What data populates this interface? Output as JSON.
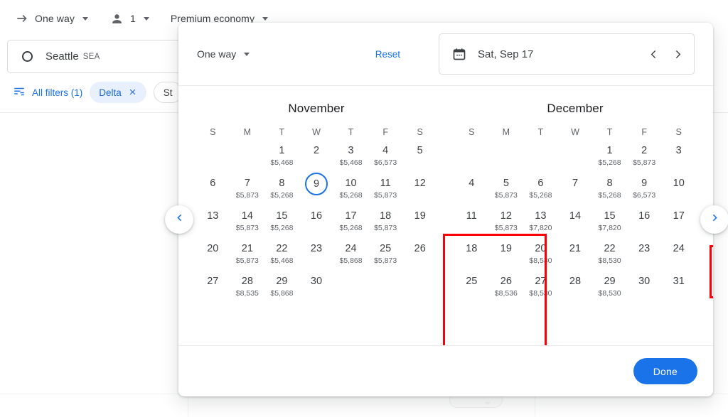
{
  "background": {
    "toolbar": {
      "trip_type": {
        "label": "One way",
        "icon": "arrow-right-icon"
      },
      "passengers": {
        "label": "1",
        "icon": "person-icon"
      },
      "cabin_class": {
        "label": "Premium economy"
      }
    },
    "search": {
      "origin_city": "Seattle",
      "origin_code": "SEA",
      "origin_icon": "circle-origin-icon"
    },
    "filters": {
      "all_filters_label": "All filters (1)",
      "all_filters_icon": "tune-icon",
      "chips": [
        {
          "label": "Delta",
          "removable": true,
          "state": "active"
        },
        {
          "label": "St",
          "removable": false,
          "state": "plain"
        }
      ]
    }
  },
  "nav": {
    "prev_icon": "chevron-left-icon",
    "next_icon": "chevron-right-icon"
  },
  "dialog": {
    "header": {
      "trip_type_label": "One way",
      "trip_type_caret": "chevron-down-icon",
      "reset_label": "Reset",
      "date_field": {
        "icon": "calendar-icon",
        "value": "Sat, Sep 17",
        "prev_icon": "chevron-left-icon",
        "next_icon": "chevron-right-icon"
      }
    },
    "weekday_headers": [
      "S",
      "M",
      "T",
      "W",
      "T",
      "F",
      "S"
    ],
    "months": [
      {
        "name": "November",
        "lead_blanks": 2,
        "days": [
          {
            "day": 1,
            "price": "$5,468"
          },
          {
            "day": 2,
            "price": ""
          },
          {
            "day": 3,
            "price": "$5,468"
          },
          {
            "day": 4,
            "price": "$6,573"
          },
          {
            "day": 5,
            "price": ""
          },
          {
            "day": 6,
            "price": ""
          },
          {
            "day": 7,
            "price": "$5,873"
          },
          {
            "day": 8,
            "price": "$5,268"
          },
          {
            "day": 9,
            "price": "",
            "selected": true
          },
          {
            "day": 10,
            "price": "$5,268"
          },
          {
            "day": 11,
            "price": "$5,873"
          },
          {
            "day": 12,
            "price": ""
          },
          {
            "day": 13,
            "price": ""
          },
          {
            "day": 14,
            "price": "$5,873"
          },
          {
            "day": 15,
            "price": "$5,268"
          },
          {
            "day": 16,
            "price": ""
          },
          {
            "day": 17,
            "price": "$5,268"
          },
          {
            "day": 18,
            "price": "$5,873"
          },
          {
            "day": 19,
            "price": ""
          },
          {
            "day": 20,
            "price": ""
          },
          {
            "day": 21,
            "price": "$5,873"
          },
          {
            "day": 22,
            "price": "$5,468"
          },
          {
            "day": 23,
            "price": ""
          },
          {
            "day": 24,
            "price": "$5,868"
          },
          {
            "day": 25,
            "price": "$5,873"
          },
          {
            "day": 26,
            "price": ""
          },
          {
            "day": 27,
            "price": ""
          },
          {
            "day": 28,
            "price": "$8,535"
          },
          {
            "day": 29,
            "price": "$5,868"
          },
          {
            "day": 30,
            "price": ""
          }
        ]
      },
      {
        "name": "December",
        "lead_blanks": 4,
        "days": [
          {
            "day": 1,
            "price": "$5,268"
          },
          {
            "day": 2,
            "price": "$5,873"
          },
          {
            "day": 3,
            "price": ""
          },
          {
            "day": 4,
            "price": ""
          },
          {
            "day": 5,
            "price": "$5,873"
          },
          {
            "day": 6,
            "price": "$5,268"
          },
          {
            "day": 7,
            "price": ""
          },
          {
            "day": 8,
            "price": "$5,268"
          },
          {
            "day": 9,
            "price": "$6,573"
          },
          {
            "day": 10,
            "price": ""
          },
          {
            "day": 11,
            "price": ""
          },
          {
            "day": 12,
            "price": "$5,873"
          },
          {
            "day": 13,
            "price": "$7,820"
          },
          {
            "day": 14,
            "price": ""
          },
          {
            "day": 15,
            "price": "$7,820"
          },
          {
            "day": 16,
            "price": ""
          },
          {
            "day": 17,
            "price": ""
          },
          {
            "day": 18,
            "price": ""
          },
          {
            "day": 19,
            "price": ""
          },
          {
            "day": 20,
            "price": "$8,530"
          },
          {
            "day": 21,
            "price": ""
          },
          {
            "day": 22,
            "price": "$8,530"
          },
          {
            "day": 23,
            "price": ""
          },
          {
            "day": 24,
            "price": ""
          },
          {
            "day": 25,
            "price": ""
          },
          {
            "day": 26,
            "price": "$8,536"
          },
          {
            "day": 27,
            "price": "$8,530"
          },
          {
            "day": 28,
            "price": ""
          },
          {
            "day": 29,
            "price": "$8,530"
          },
          {
            "day": 30,
            "price": ""
          },
          {
            "day": 31,
            "price": ""
          }
        ]
      }
    ],
    "footer": {
      "done_label": "Done"
    }
  },
  "annotations": {
    "boxes": [
      {
        "name": "november-highlight",
        "color": "#fb0007"
      },
      {
        "name": "december-highlight",
        "color": "#fb0007"
      }
    ]
  },
  "colors": {
    "accent_blue": "#1a73e8",
    "chip_blue_bg": "#e8f0fe",
    "annotation_red": "#fb0007",
    "text_primary": "#3c4043",
    "text_secondary": "#5f6368"
  }
}
